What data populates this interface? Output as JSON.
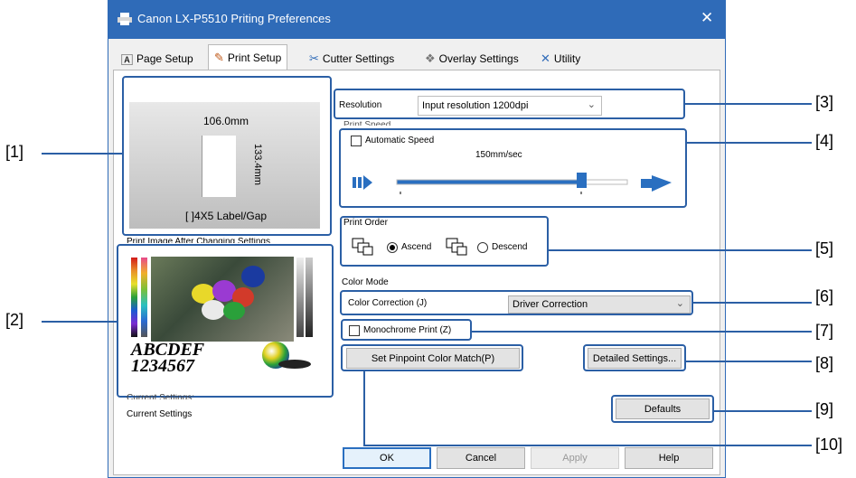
{
  "window": {
    "title": "Canon LX-P5510 Priting Preferences",
    "close_glyph": "✕"
  },
  "tabs": [
    {
      "label": "Page Setup",
      "icon": "page-setup-icon"
    },
    {
      "label": "Print Setup",
      "icon": "brush-icon"
    },
    {
      "label": "Cutter Settings",
      "icon": "scissors-icon"
    },
    {
      "label": "Overlay Settings",
      "icon": "overlay-icon"
    },
    {
      "label": "Utility",
      "icon": "tools-icon"
    }
  ],
  "preview": {
    "width_label": "106.0mm",
    "height_label": "133.4mm",
    "media_label": "[ ]4X5 Label/Gap"
  },
  "print_image": {
    "title": "Print Image After Changing Settings",
    "sample_text_line1": "ABCDEF",
    "sample_text_line2": "1234567"
  },
  "current_settings": {
    "heading": "Current Settings:",
    "value": "Current Settings"
  },
  "resolution": {
    "label": "Resolution",
    "value": "Input resolution 1200dpi"
  },
  "print_speed": {
    "group_label": "Print Speed",
    "automatic_label": "Automatic Speed",
    "automatic_checked": false,
    "speed_value": "150mm/sec",
    "slider_level": 0.8
  },
  "print_order": {
    "group_label": "Print Order",
    "ascend_label": "Ascend",
    "descend_label": "Descend",
    "selected": "Ascend"
  },
  "color_mode": {
    "group_label": "Color Mode",
    "correction_label": "Color Correction (J)",
    "correction_value": "Driver Correction",
    "monochrome_label": "Monochrome Print (Z)",
    "monochrome_checked": false,
    "pinpoint_button": "Set Pinpoint Color Match(P)",
    "detailed_button": "Detailed Settings..."
  },
  "defaults_button": "Defaults",
  "footer": {
    "ok": "OK",
    "cancel": "Cancel",
    "apply": "Apply",
    "help": "Help"
  },
  "annotations": [
    "[1]",
    "[2]",
    "[3]",
    "[4]",
    "[5]",
    "[6]",
    "[7]",
    "[8]",
    "[9]",
    "[10]"
  ],
  "colors": {
    "title_bar": "#2f6bb8",
    "callout": "#2b5fa5",
    "slider": "#2a6fc0"
  }
}
